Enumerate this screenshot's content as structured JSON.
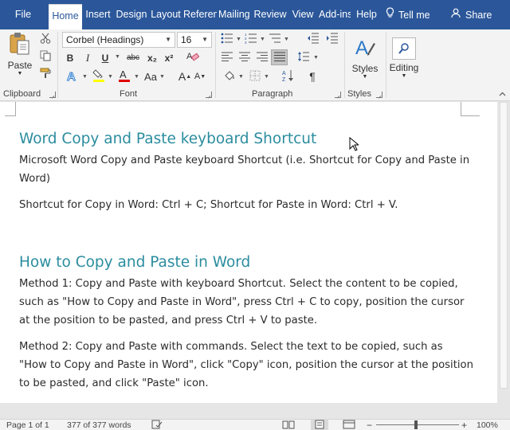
{
  "tabs": [
    {
      "label": "File",
      "active": false
    },
    {
      "label": "Home",
      "active": true
    },
    {
      "label": "Insert",
      "active": false
    },
    {
      "label": "Design",
      "active": false
    },
    {
      "label": "Layout",
      "active": false
    },
    {
      "label": "References",
      "active": false
    },
    {
      "label": "Mailings",
      "active": false
    },
    {
      "label": "Review",
      "active": false
    },
    {
      "label": "View",
      "active": false
    },
    {
      "label": "Add-ins",
      "active": false
    },
    {
      "label": "Help",
      "active": false
    }
  ],
  "tell_me": "Tell me",
  "share": "Share",
  "ribbon": {
    "clipboard": {
      "label": "Clipboard",
      "paste": "Paste"
    },
    "font": {
      "label": "Font",
      "font_name": "Corbel (Headings)",
      "font_size": "16",
      "bold": "B",
      "italic": "I",
      "underline": "U",
      "strikethrough": "abc",
      "subscript": "x₂",
      "superscript": "x²",
      "grow": "A",
      "shrink": "A",
      "case": "Aa"
    },
    "paragraph": {
      "label": "Paragraph",
      "pilcrow": "¶"
    },
    "styles": {
      "label": "Styles",
      "button": "Styles"
    },
    "editing": {
      "button": "Editing"
    }
  },
  "document": {
    "heading1": "Word Copy and Paste keyboard Shortcut",
    "para1": "Microsoft Word Copy and Paste keyboard Shortcut (i.e. Shortcut for Copy and Paste in Word)",
    "para2": "Shortcut for Copy in Word: Ctrl + C; Shortcut for Paste in Word: Ctrl + V.",
    "heading2": "How to Copy and Paste in Word",
    "para3": "Method 1: Copy and Paste with keyboard Shortcut. Select the content to be copied, such as \"How to Copy and Paste in Word\", press Ctrl + C to copy, position the cursor at the position to be pasted, and press Ctrl + V to paste.",
    "para4": "Method 2: Copy and Paste with commands. Select the text to be copied, such as \"How to Copy and Paste in Word\", click \"Copy\" icon, position the cursor at the position to be pasted, and click \"Paste\" icon."
  },
  "status_bar": {
    "page": "Page 1 of 1",
    "words": "377 of 377 words",
    "zoom": "100%",
    "zoom_minus": "−",
    "zoom_plus": "+"
  },
  "colors": {
    "tab_bar": "#2b579a",
    "heading": "#2b8d9f",
    "highlight": "#ffff00",
    "font_color": "#e00000"
  }
}
